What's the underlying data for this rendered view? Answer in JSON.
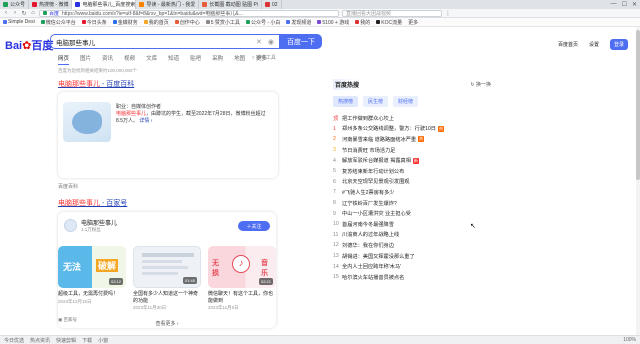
{
  "browser": {
    "tabs": [
      {
        "label": "公众号",
        "color": "#1ea05a",
        "active": false
      },
      {
        "label": "热搜榜 - 微博",
        "color": "#e6162d",
        "active": false
      },
      {
        "label": "电脑那些事儿_百度搜索",
        "color": "#2932e1",
        "active": true
      },
      {
        "label": "导读 - 最新热门 - 我爱",
        "color": "#ff8200",
        "active": false
      },
      {
        "label": "长截图 截动图 贴图 Pi",
        "color": "#e65d3c",
        "active": false
      },
      {
        "label": "02",
        "color": "#d33",
        "active": false
      }
    ],
    "url": "https://www.baidu.com/s?ie=utf-8&f=8&rsv_bp=1&tn=baidu&wd=电脑那些事儿&...",
    "url_prefix": "百度",
    "search_hint": "直播回看大团战视频",
    "bookmarks": [
      "Simple Desi",
      "微信公众平台",
      "今日头条",
      "金蝶财务",
      "我的首页",
      "创作中心",
      "5 赞赏小工具",
      "公众号 - 小白",
      "发现频道",
      "5100 + 游戏",
      "我的",
      "KOC流量",
      "更多"
    ]
  },
  "header": {
    "logo_a": "Bai",
    "logo_b": "百度",
    "query": "电脑那些事儿",
    "search_button": "百度一下",
    "links": [
      "百度首页",
      "设置",
      "登录"
    ]
  },
  "nav_tabs": [
    "网页",
    "图片",
    "资讯",
    "视频",
    "文库",
    "知道",
    "贴吧",
    "采购",
    "地图",
    "更多"
  ],
  "search_tool": "搜索工具",
  "result_count": "百度为您找到相关结果约100,000,000个",
  "result1": {
    "title_em": "电脑那些事儿",
    "title_rest": " - 百度百科",
    "summary_prefix": "职业：自媒体创作者",
    "summary_em": "电脑那些事儿",
    "summary_rest": "，由蹲坑的学生，截至2022年7月28日，微博粉丝超过8.5万人。",
    "more": "详情 ›",
    "source": "百度百科"
  },
  "result2": {
    "title_em": "电脑那些事儿",
    "title_rest": " - 百家号",
    "account": "电脑那些事儿",
    "fans": "1.1万粉丝",
    "follow": "关注",
    "videos": [
      {
        "title": "超级工具，无需再付费吗！",
        "date": "2023年12月15日",
        "duration": "02:12",
        "c1": "#5ab9e8",
        "c2": "#f7d56b"
      },
      {
        "title": "全国有多少人知道这一个神奇的功能",
        "date": "2023年11月30日",
        "duration": "01:45",
        "c1": "#eef2f6",
        "c2": "#c9d3de"
      },
      {
        "title": "微信聊天！有这个工具，你也能做到",
        "date": "2023年11月5日",
        "duration": "02:21",
        "c1": "#f9d7dc",
        "c2": "#fbecef"
      }
    ],
    "see_more": "查看更多 ›",
    "source": "百家号"
  },
  "hot": {
    "title": "百度热搜",
    "refresh": "换一换",
    "chips": [
      "热搜榜",
      "民生榜",
      "财经榜"
    ],
    "items": [
      {
        "rank": "顶",
        "text": "把工作做到群众心坎上",
        "tag": ""
      },
      {
        "rank": "1",
        "text": "郑州多条公交路线调整，警方：行驶10日",
        "tag": "热"
      },
      {
        "rank": "2",
        "text": "河南暴雪来临 道路路面结冰严重",
        "tag": "热"
      },
      {
        "rank": "3",
        "text": "节日消费旺 市场活力足",
        "tag": ""
      },
      {
        "rank": "4",
        "text": "解放军驳斥台媒报道 揭露真相",
        "tag": "新"
      },
      {
        "rank": "5",
        "text": "复苏结束新年行动计划公布",
        "tag": ""
      },
      {
        "rank": "6",
        "text": "北京天空现罕见景观引发围观",
        "tag": ""
      },
      {
        "rank": "7",
        "text": "#飞驰人生2票房有多少",
        "tag": ""
      },
      {
        "rank": "8",
        "text": "辽宁铁岭百厂发生爆炸?",
        "tag": ""
      },
      {
        "rank": "9",
        "text": "中山一小区遭洪灾 业主担心受",
        "tag": ""
      },
      {
        "rank": "10",
        "text": "首届河南今冬最强降雪",
        "tag": ""
      },
      {
        "rank": "11",
        "text": "川渝商人的过年战略上线",
        "tag": ""
      },
      {
        "rank": "12",
        "text": "刘德华：我在你们身边",
        "tag": ""
      },
      {
        "rank": "13",
        "text": "胡锡进：美国又挥霍没那么重了",
        "tag": ""
      },
      {
        "rank": "14",
        "text": "全内人士回应跨年称'木马'",
        "tag": ""
      },
      {
        "rank": "15",
        "text": "哈尔滨火车站播音员被点名",
        "tag": ""
      }
    ]
  },
  "status": {
    "left": [
      "今日优选",
      "热点资讯",
      "快速剪辑",
      "下载",
      "小窗"
    ],
    "right": [
      "100%"
    ]
  }
}
